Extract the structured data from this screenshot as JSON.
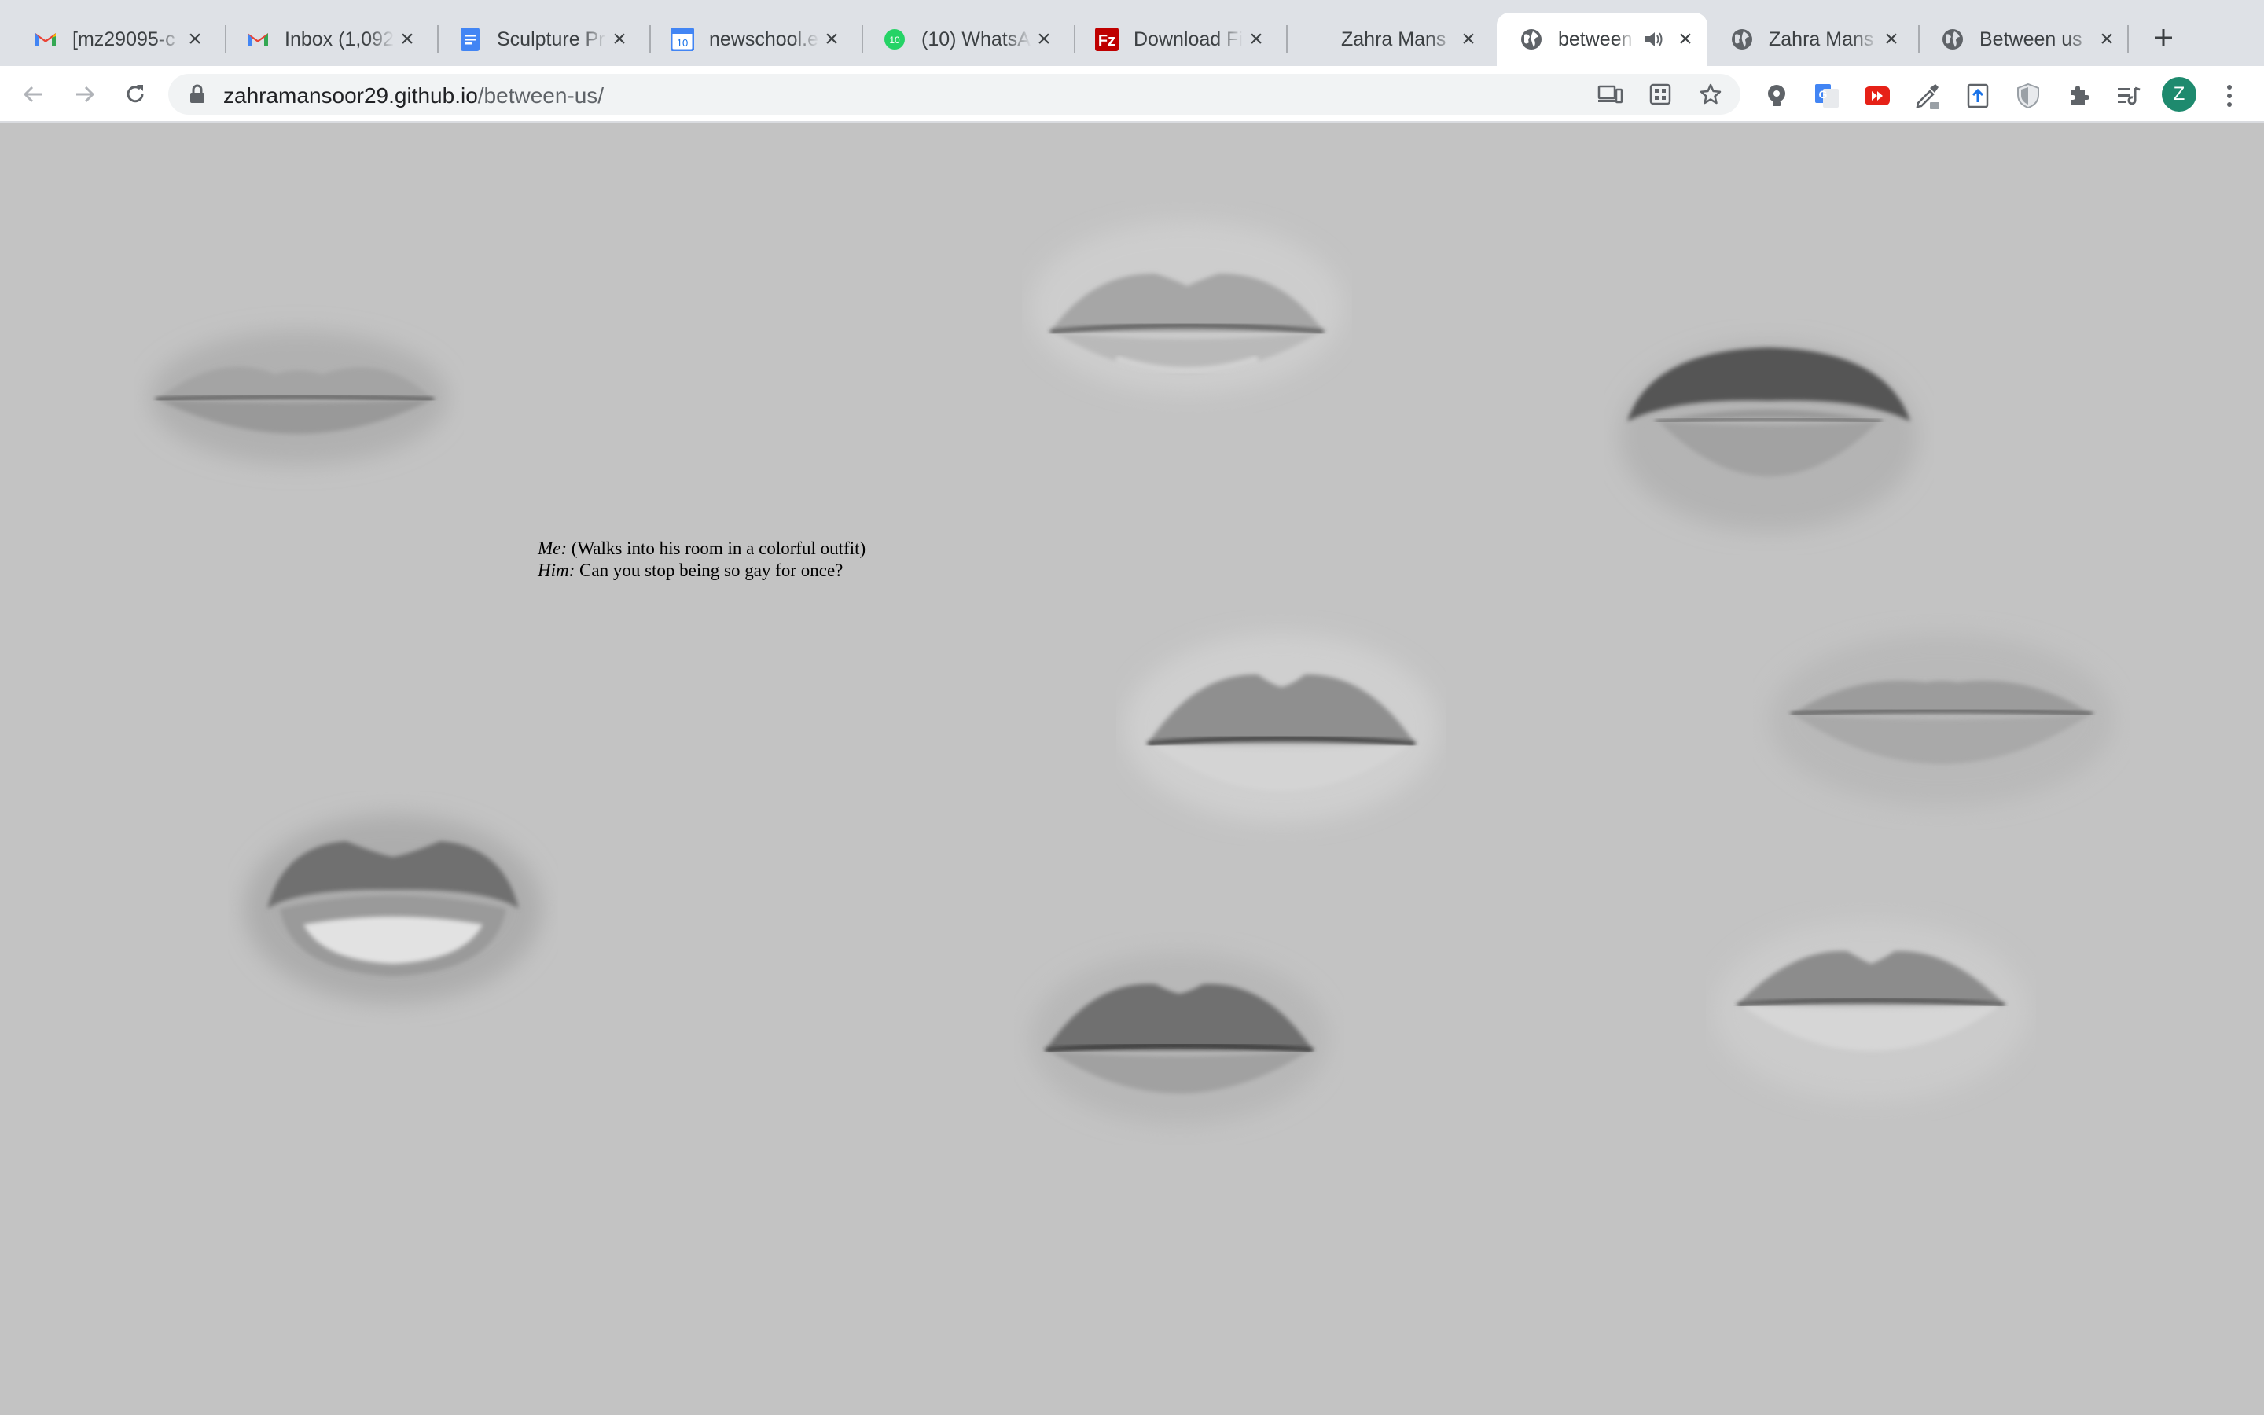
{
  "browser": {
    "tabs": [
      {
        "title": "[mz29095-c",
        "icon": "gmail-icon"
      },
      {
        "title": "Inbox (1,092",
        "icon": "gmail-icon"
      },
      {
        "title": "Sculpture Pr",
        "icon": "google-docs-icon"
      },
      {
        "title": "newschool.e",
        "icon": "calendar-icon"
      },
      {
        "title": "(10) WhatsA",
        "icon": "whatsapp-icon"
      },
      {
        "title": "Download Fi",
        "icon": "filezilla-icon"
      },
      {
        "title": "Zahra Mans",
        "icon": "none"
      },
      {
        "title": "between",
        "icon": "globe-icon",
        "active": true,
        "audio": true
      },
      {
        "title": "Zahra Mans",
        "icon": "globe-icon"
      },
      {
        "title": "Between us",
        "icon": "globe-icon"
      }
    ],
    "address": {
      "domain": "zahramansoor29.github.io",
      "path": "/between-us/"
    },
    "profile_initial": "Z"
  },
  "page": {
    "dialogue": [
      {
        "speaker": "Me:",
        "line": "(Walks into his room in a colorful outfit)"
      },
      {
        "speaker": "Him:",
        "line": "Can you stop being so gay for once?"
      }
    ],
    "images": [
      "lips-image",
      "lips-image",
      "mustache-lips-image",
      "lips-image",
      "lips-image",
      "lips-image",
      "lips-image",
      "lips-image"
    ]
  },
  "colors": {
    "page_background": "#c3c3c3",
    "tabstrip_background": "#dee1e6",
    "toolbar_background": "#ffffff",
    "avatar": "#1e8a6e"
  }
}
